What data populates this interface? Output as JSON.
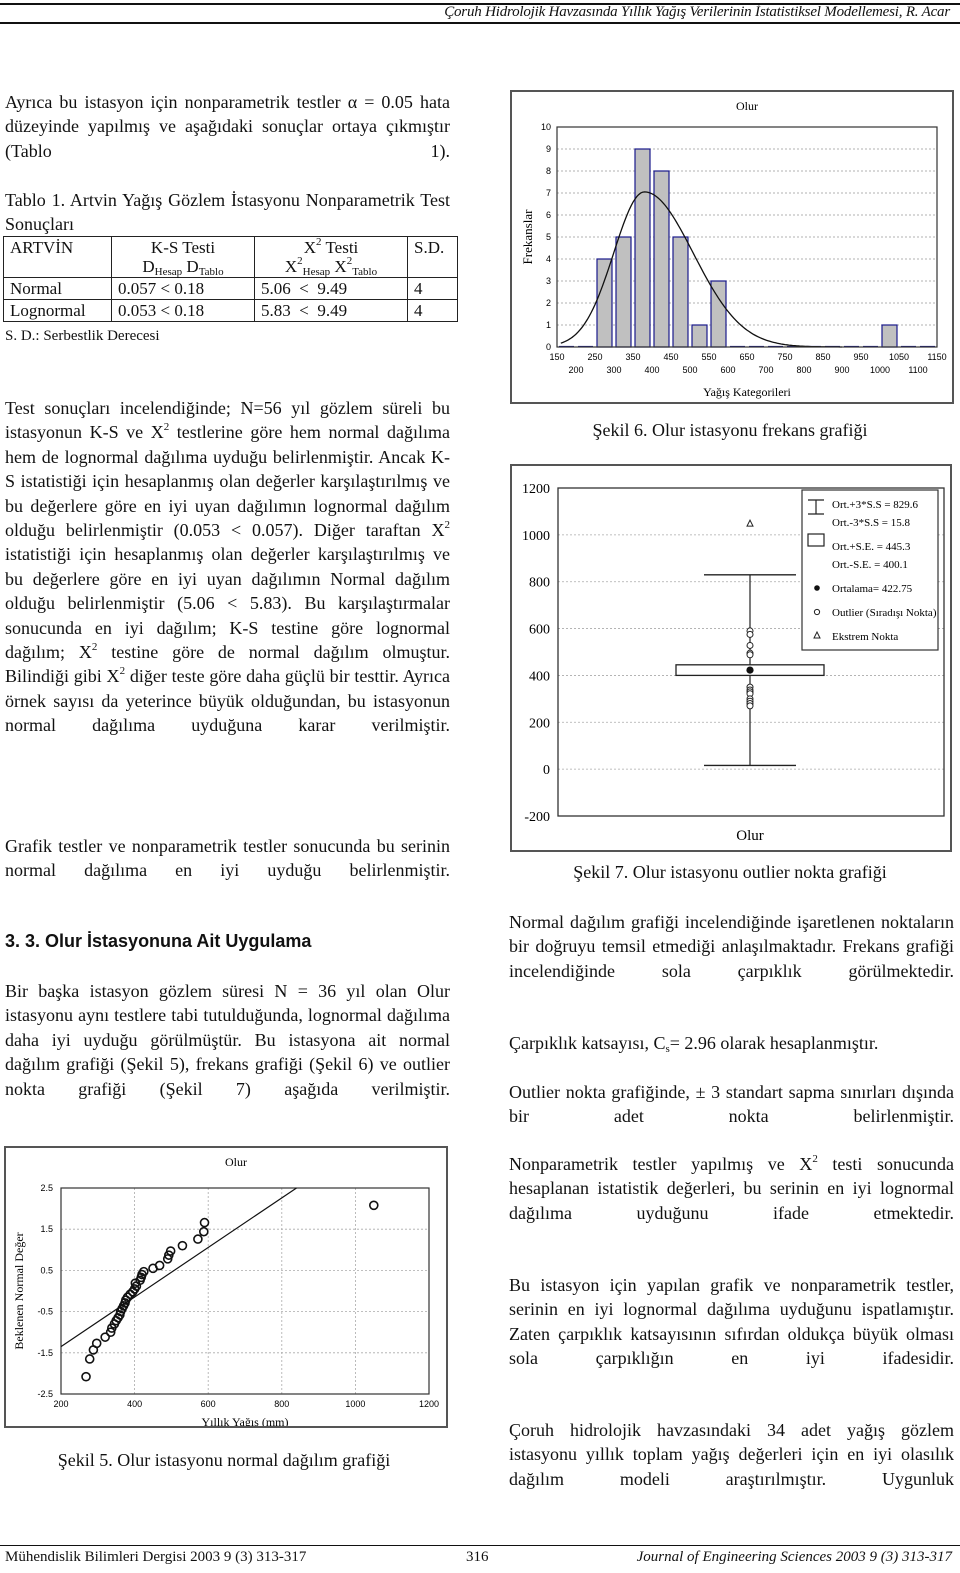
{
  "header": {
    "running_title": "Çoruh Hidrolojik Havzasında Yıllık Yağış Verilerinin İstatistiksel Modellemesi, R. Acar"
  },
  "footer": {
    "left": "Mühendislik Bilimleri Dergisi  2003 9 (3)  313-317",
    "page_number": "316",
    "right": "Journal of Engineering Sciences 2003  9 (3) 313-317"
  },
  "left_column": {
    "intro_paragraph": "Ayrıca bu istasyon için nonparametrik testler α = 0.05 hata düzeyinde yapılmış ve aşağıdaki sonuçlar ortaya çıkmıştır (Tablo 1).",
    "table_caption": "Tablo 1. Artvin Yağış Gözlem İstasyonu Nonparametrik Test Sonuçları",
    "table": {
      "station": "ARTVİN",
      "ks_header": "K-S Testi",
      "ks_sub1": "D",
      "ks_sub1_idx": "Hesap",
      "ks_sub2": "D",
      "ks_sub2_idx": "Tablo",
      "chi_header": "X",
      "chi_header_sup": "2",
      "chi_header_rest": " Testi",
      "chi_sub1": "X",
      "chi_sub1_idx": "Hesap",
      "chi_sub2": "X",
      "chi_sub2_idx": "Tablo",
      "sup2": "2",
      "sd_header": "S.D.",
      "rows": [
        {
          "dist": "Normal",
          "ks": "0.057 < 0.18",
          "chi": "5.06  <  9.49",
          "sd": "4"
        },
        {
          "dist": "Lognormal",
          "ks": "0.053 < 0.18",
          "chi": "5.83  <  9.49",
          "sd": "4"
        }
      ],
      "note": "S. D.: Serbestlik Derecesi"
    },
    "para_test_results": {
      "a": "Test sonuçları incelendiğinde; N=56 yıl gözlem süreli bu istasyonun K-S ve X",
      "b": " testlerine göre hem normal dağılıma hem de lognormal dağılıma uyduğu belirlenmiştir. Ancak K-S istatistiği için hesaplanmış olan değerler karşılaştırılmış ve bu değerlere göre en iyi uyan dağılımın lognormal dağılım olduğu belirlenmiştir (0.053 < 0.057). Diğer taraftan X",
      "c": " istatistiği için hesaplanmış olan değerler karşılaştırılmış ve bu değerlere göre en iyi uyan dağılımın Normal dağılım olduğu belirlenmiştir (5.06 < 5.83). Bu karşılaştırmalar sonucunda en iyi dağılım; K-S testine göre lognormal dağılım; X",
      "d": " testine göre de normal dağılım olmuştur. Bilindiği gibi X",
      "e": " diğer teste göre daha güçlü bir testtir. Ayrıca örnek sayısı da yeterince büyük olduğundan, bu istasyonun normal dağılıma uyduğuna karar verilmiştir.",
      "sup": "2"
    },
    "para_conclusion": "Grafik testler ve nonparametrik testler sonucunda bu serinin normal dağılıma en iyi uyduğu belirlenmiştir.",
    "section_heading": "3. 3. Olur İstasyonuna Ait Uygulama",
    "para_olur": "Bir başka istasyon gözlem süresi N = 36 yıl olan Olur istasyonu aynı testlere tabi tutulduğunda, lognormal dağılıma daha iyi uyduğu görülmüştür. Bu istasyona ait normal dağılım grafiği (Şekil 5), frekans grafiği (Şekil 6) ve outlier nokta grafiği (Şekil 7) aşağıda verilmiştir.",
    "fig5_caption": "Şekil 5. Olur istasyonu  normal dağılım grafiği"
  },
  "right_column": {
    "fig6_caption": "Şekil 6. Olur istasyonu  frekans grafiği",
    "fig7_caption": "Şekil 7. Olur istasyonu outlier nokta grafiği",
    "para_normal_plot": "Normal dağılım grafiği incelendiğinde işaretlenen noktaların bir doğruyu temsil etmediği anlaşılmaktadır. Frekans grafiği incelendiğinde sola çarpıklık görülmektedir.",
    "para_skew": {
      "a": "Çarpıklık katsayısı, C",
      "sub": "s",
      "b": "= 2.96 olarak hesaplanmıştır."
    },
    "para_outlier": "Outlier nokta grafiğinde, ± 3 standart sapma sınırları dışında bir adet nokta belirlenmiştir.",
    "para_nonparam": {
      "a": "Nonparametrik testler yapılmış ve X",
      "sup": "2",
      "b": " testi sonucunda hesaplanan istatistik değerleri, bu serinin en iyi lognormal dağılıma uyduğunu ifade etmektedir."
    },
    "para_proof": "Bu istasyon için yapılan grafik ve nonparametrik testler, serinin en iyi lognormal dağılıma uyduğunu ispatlamıştır. Zaten çarpıklık katsayısının sıfırdan oldukça büyük olması sola çarpıklığın en iyi ifadesidir.",
    "para_final": "Çoruh hidrolojik havzasındaki 34 adet yağış gözlem istasyonu yıllık toplam yağış değerleri için en iyi olasılık dağılım modeli araştırılmıştır. Uygunluk"
  },
  "chart_data": [
    {
      "id": "fig6",
      "type": "bar",
      "title": "Olur",
      "xlabel": "Yağış Kategorileri",
      "ylabel": "Frekanslar",
      "x_ticks_upper": [
        "150",
        "250",
        "350",
        "450",
        "550",
        "650",
        "750",
        "850",
        "950",
        "1050",
        "1150"
      ],
      "x_ticks_lower": [
        "200",
        "300",
        "400",
        "500",
        "600",
        "700",
        "800",
        "900",
        "1000",
        "1100"
      ],
      "xlim": [
        150,
        1150
      ],
      "ylim": [
        0,
        10
      ],
      "y_ticks": [
        0,
        1,
        2,
        3,
        4,
        5,
        6,
        7,
        8,
        9,
        10
      ],
      "bin_width": 50,
      "bin_starts": [
        150,
        200,
        250,
        300,
        350,
        400,
        450,
        500,
        550,
        600,
        650,
        700,
        750,
        800,
        850,
        900,
        950,
        1000,
        1050,
        1100
      ],
      "values": [
        0,
        0,
        4,
        5,
        9,
        8,
        5,
        1,
        3,
        0,
        0,
        0,
        0,
        0,
        0,
        0,
        0,
        1,
        0,
        0
      ],
      "fit_curve": {
        "name": "normal fit",
        "peak_x": 380,
        "peak_y": 7.05,
        "sigma": 95,
        "skew_right": true
      },
      "grid": true,
      "bar_fill": "#c0c0c0",
      "bar_edge": "#1a1a8c"
    },
    {
      "id": "fig7",
      "type": "box",
      "xlabel": "Olur",
      "ylim": [
        -200,
        1200
      ],
      "y_ticks": [
        -200,
        0,
        200,
        400,
        600,
        800,
        1000,
        1200
      ],
      "whisker_high": 829.6,
      "whisker_low": 15.8,
      "box_high": 445.3,
      "box_low": 400.1,
      "mean": 422.75,
      "outliers": [
        590,
        575,
        528,
        495,
        488,
        350,
        338,
        330,
        322,
        300,
        290,
        280,
        270
      ],
      "extremes": [
        1050
      ],
      "legend": [
        "Ort.+3*S.S = 829.6",
        "Ort.-3*S.S = 15.8",
        "Ort.+S.E. = 445.3",
        "Ort.-S.E. = 400.1",
        "Ortalama= 422.75",
        "Outlier (Sıradışı Nokta)",
        "Ekstrem Nokta"
      ],
      "legend_position": "top-right",
      "grid": true
    },
    {
      "id": "fig5",
      "type": "scatter",
      "title": "Olur",
      "xlabel": "Yıllık Yağış (mm)",
      "ylabel": "Beklenen Normal Değer",
      "xlim": [
        200,
        1200
      ],
      "ylim": [
        -2.5,
        2.5
      ],
      "x_ticks": [
        200,
        400,
        600,
        800,
        1000,
        1200
      ],
      "y_ticks": [
        -2.5,
        -1.5,
        -0.5,
        0.5,
        1.5,
        2.5
      ],
      "points": [
        [
          268,
          -2.08
        ],
        [
          278,
          -1.65
        ],
        [
          288,
          -1.43
        ],
        [
          297,
          -1.27
        ],
        [
          320,
          -1.12
        ],
        [
          335,
          -1.0
        ],
        [
          338,
          -0.9
        ],
        [
          345,
          -0.8
        ],
        [
          350,
          -0.72
        ],
        [
          355,
          -0.65
        ],
        [
          360,
          -0.58
        ],
        [
          362,
          -0.5
        ],
        [
          366,
          -0.43
        ],
        [
          370,
          -0.36
        ],
        [
          374,
          -0.29
        ],
        [
          376,
          -0.22
        ],
        [
          381,
          -0.15
        ],
        [
          388,
          -0.08
        ],
        [
          395,
          -0.02
        ],
        [
          400,
          0.05
        ],
        [
          405,
          0.12
        ],
        [
          402,
          0.19
        ],
        [
          415,
          0.26
        ],
        [
          418,
          0.33
        ],
        [
          420,
          0.4
        ],
        [
          425,
          0.47
        ],
        [
          450,
          0.55
        ],
        [
          468,
          0.62
        ],
        [
          490,
          0.78
        ],
        [
          493,
          0.87
        ],
        [
          498,
          0.97
        ],
        [
          530,
          1.1
        ],
        [
          572,
          1.26
        ],
        [
          588,
          1.44
        ],
        [
          590,
          1.66
        ],
        [
          1050,
          2.08
        ]
      ],
      "reference_line": {
        "from": [
          200,
          -1.35
        ],
        "to": [
          840,
          2.5
        ]
      },
      "grid": true
    }
  ]
}
